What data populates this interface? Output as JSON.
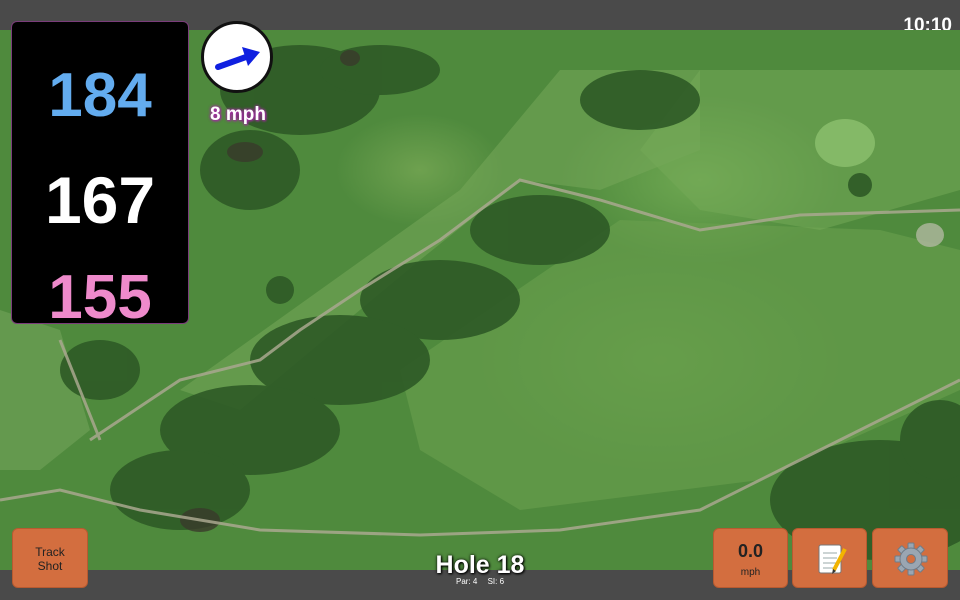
{
  "status": {
    "time": "10:10"
  },
  "distances": {
    "back": "184",
    "middle": "167",
    "front": "155"
  },
  "wind": {
    "speed": "8 mph",
    "arrow_color": "#1020e0"
  },
  "hole": {
    "title": "Hole 18",
    "par": "Par: 4",
    "si": "SI: 6"
  },
  "buttons": {
    "track_line1": "Track",
    "track_line2": "Shot",
    "speed_value": "0.0",
    "speed_unit": "mph",
    "notes_icon": "notepad-pencil-icon",
    "settings_icon": "gear-icon"
  },
  "colors": {
    "back_distance": "#63acef",
    "middle_distance": "#ffffff",
    "front_distance": "#ee8acb",
    "button": "#d36e3f"
  }
}
